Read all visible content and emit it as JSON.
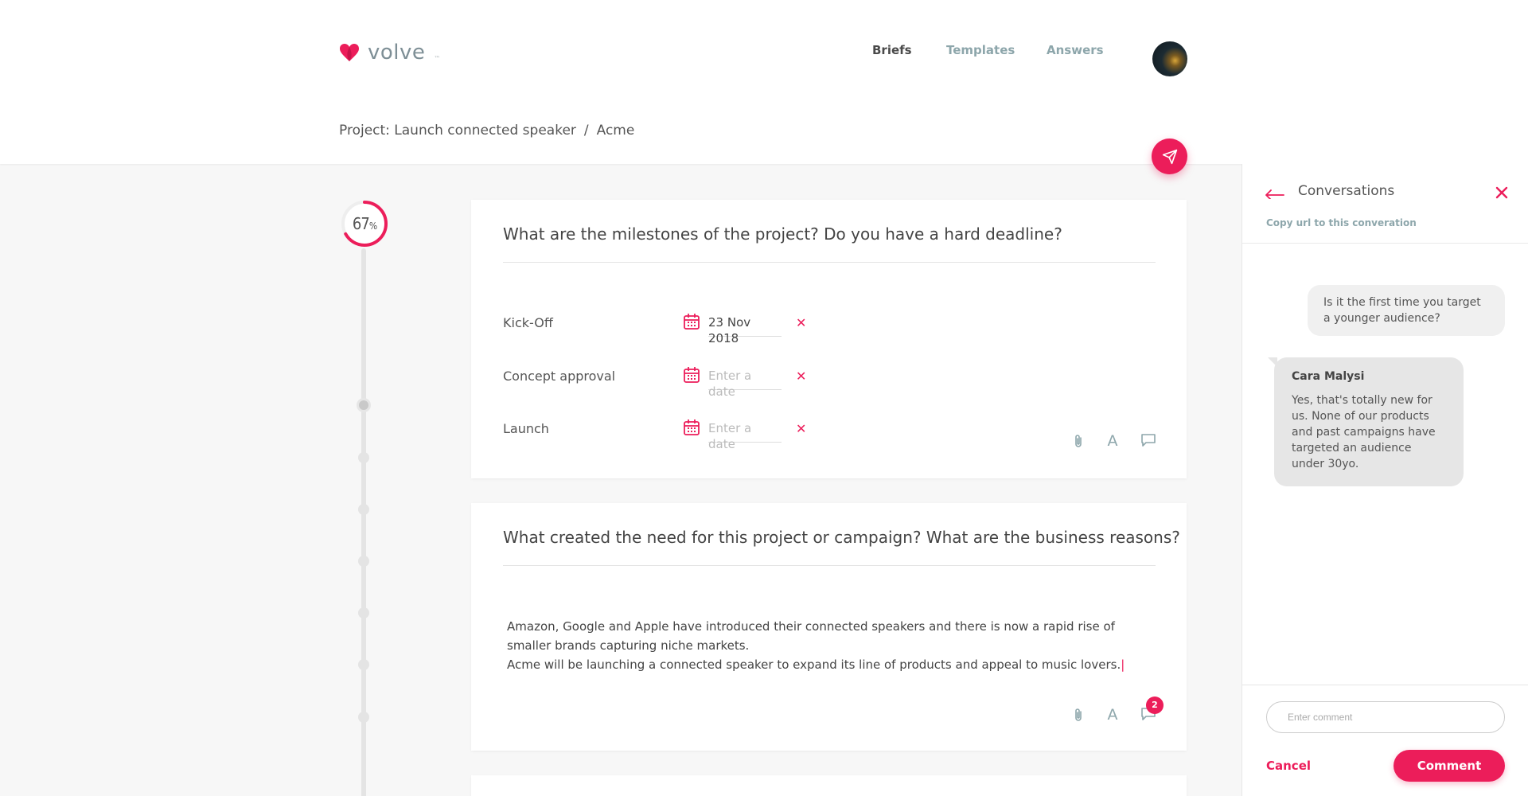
{
  "header": {
    "logo_text": "volve",
    "logo_tm": "™",
    "nav": [
      {
        "label": "Briefs",
        "active": true
      },
      {
        "label": "Templates",
        "active": false
      },
      {
        "label": "Answers",
        "active": false
      }
    ]
  },
  "breadcrumb": {
    "project": "Project: Launch connected speaker",
    "separator": "/",
    "client": "Acme"
  },
  "progress": {
    "value": 67,
    "unit": "%"
  },
  "cards": [
    {
      "title": "What are the milestones of the project? Do you have a hard deadline?",
      "milestones": [
        {
          "label": "Kick-Off",
          "date": "23 Nov 2018",
          "placeholder": "Enter a date"
        },
        {
          "label": "Concept approval",
          "date": "",
          "placeholder": "Enter a date"
        },
        {
          "label": "Launch",
          "date": "",
          "placeholder": "Enter a date"
        }
      ],
      "remove_label": "✕"
    },
    {
      "title": "What created the need for this project or campaign? What are the business reasons?",
      "answer_lines": [
        "Amazon, Google and Apple have introduced their connected speakers and there is now a rapid rise of smaller brands capturing niche markets.",
        "Acme will be launching a connected speaker to expand its line of products and appeal to music lovers."
      ],
      "comment_count": "2"
    }
  ],
  "tools": {
    "text_label": "A"
  },
  "conversations": {
    "title": "Conversations",
    "copy_link": "Copy url to this converation",
    "messages": [
      {
        "direction": "out",
        "text": "Is it the first time you target a younger audience?"
      },
      {
        "direction": "in",
        "author": "Cara Malysi",
        "text": "Yes, that's totally new for us. None of our products and past campaigns have targeted an audience under 30yo."
      }
    ],
    "input_placeholder": "Enter comment",
    "cancel_label": "Cancel",
    "submit_label": "Comment"
  },
  "colors": {
    "accent": "#ec1d5a",
    "muted": "#8da6ab",
    "background": "#f7f7f7"
  },
  "icons": [
    "heart-logo-icon",
    "send-icon",
    "calendar-icon",
    "close-icon",
    "paperclip-icon",
    "text-format-icon",
    "comment-icon",
    "back-arrow-icon"
  ]
}
